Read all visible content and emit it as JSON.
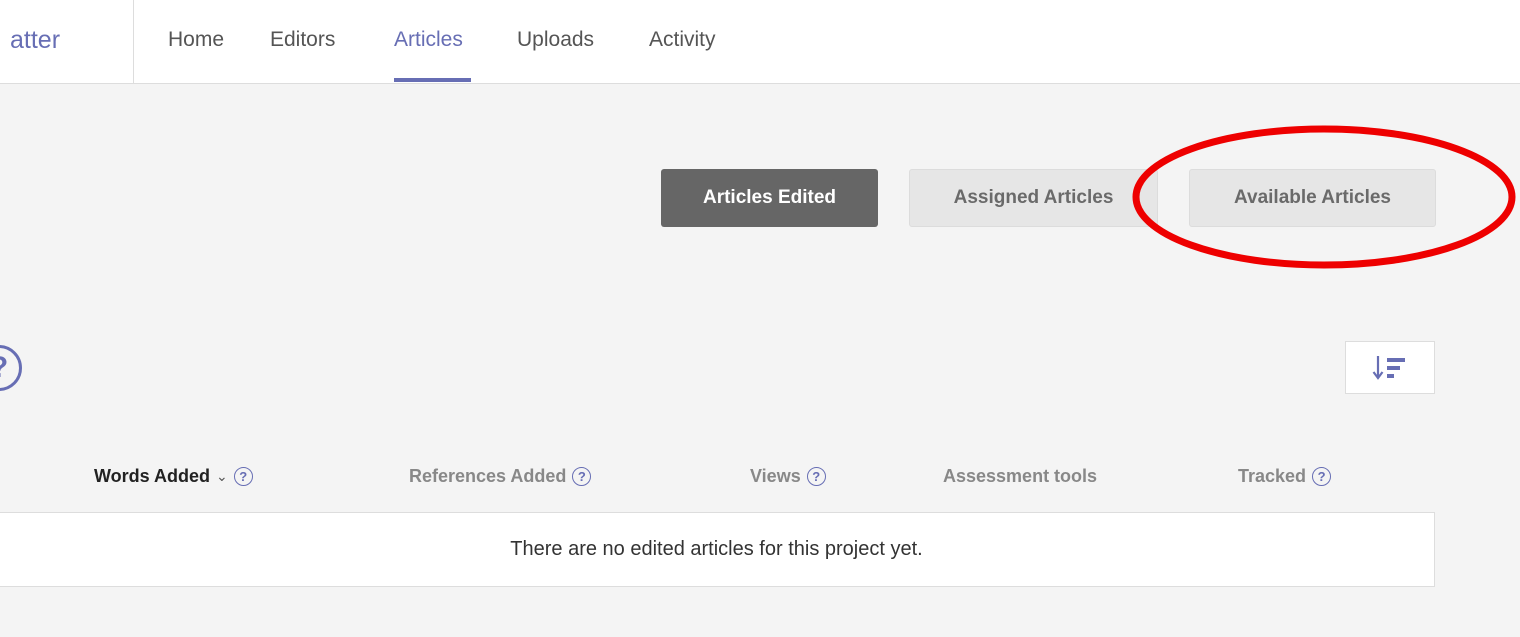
{
  "header": {
    "brand": "atter",
    "nav": [
      {
        "label": "Home",
        "active": false
      },
      {
        "label": "Editors",
        "active": false
      },
      {
        "label": "Articles",
        "active": true
      },
      {
        "label": "Uploads",
        "active": false
      },
      {
        "label": "Activity",
        "active": false
      }
    ]
  },
  "article_tabs": [
    {
      "label": "Articles Edited",
      "active": true
    },
    {
      "label": "Assigned Articles",
      "active": false
    },
    {
      "label": "Available Articles",
      "active": false
    }
  ],
  "annotation": {
    "shape": "ellipse",
    "color": "#ee0000",
    "target": "Available Articles"
  },
  "help_glyph": "?",
  "sort_button": {
    "icon": "sort-descending-icon"
  },
  "table": {
    "columns": [
      {
        "label": "Words Added",
        "sorted": true,
        "help": true
      },
      {
        "label": "References Added",
        "help": true
      },
      {
        "label": "Views",
        "help": true
      },
      {
        "label": "Assessment tools",
        "help": false
      },
      {
        "label": "Tracked",
        "help": true
      }
    ],
    "empty_message": "There are no edited articles for this project yet."
  },
  "colors": {
    "accent": "#676eb4",
    "active_tab": "#666666",
    "background": "#f4f4f4",
    "annotation": "#ee0000"
  }
}
